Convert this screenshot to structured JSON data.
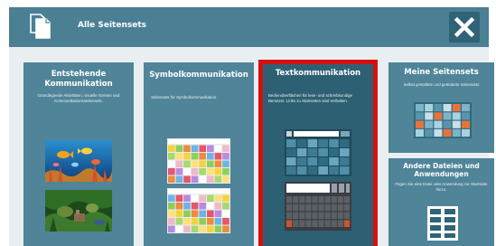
{
  "header": {
    "title": "Alle Seitensets",
    "pages_icon": "pages-icon",
    "close_icon": "close-icon"
  },
  "cards": [
    {
      "title": "Entstehende Kommunikation",
      "description": "Grundlegende Aktivitäten, visuelle Szenen und Kommunikationsseitensets."
    },
    {
      "title": "Symbolkommunikation",
      "description": "Seitensets für Symbolkommunikation."
    },
    {
      "title": "Textkommunikation",
      "description": "Bedienoberflächen für lese- und schreibkundige Benutzer. Links zu Startseiten sind enthalten.",
      "selected": true
    },
    {
      "title": "Meine Seitensets",
      "description": "Selbst gestaltete und geänderte Seitensets"
    },
    {
      "title": "Andere Dateien und Anwendungen",
      "description": "Fügen Sie eine Datei oder Anwendung zur Startseite hinzu."
    }
  ],
  "colors": {
    "header": "#4a7f94",
    "card": "#4f8499",
    "selected_border": "#d21010",
    "background": "#e9eef0"
  }
}
